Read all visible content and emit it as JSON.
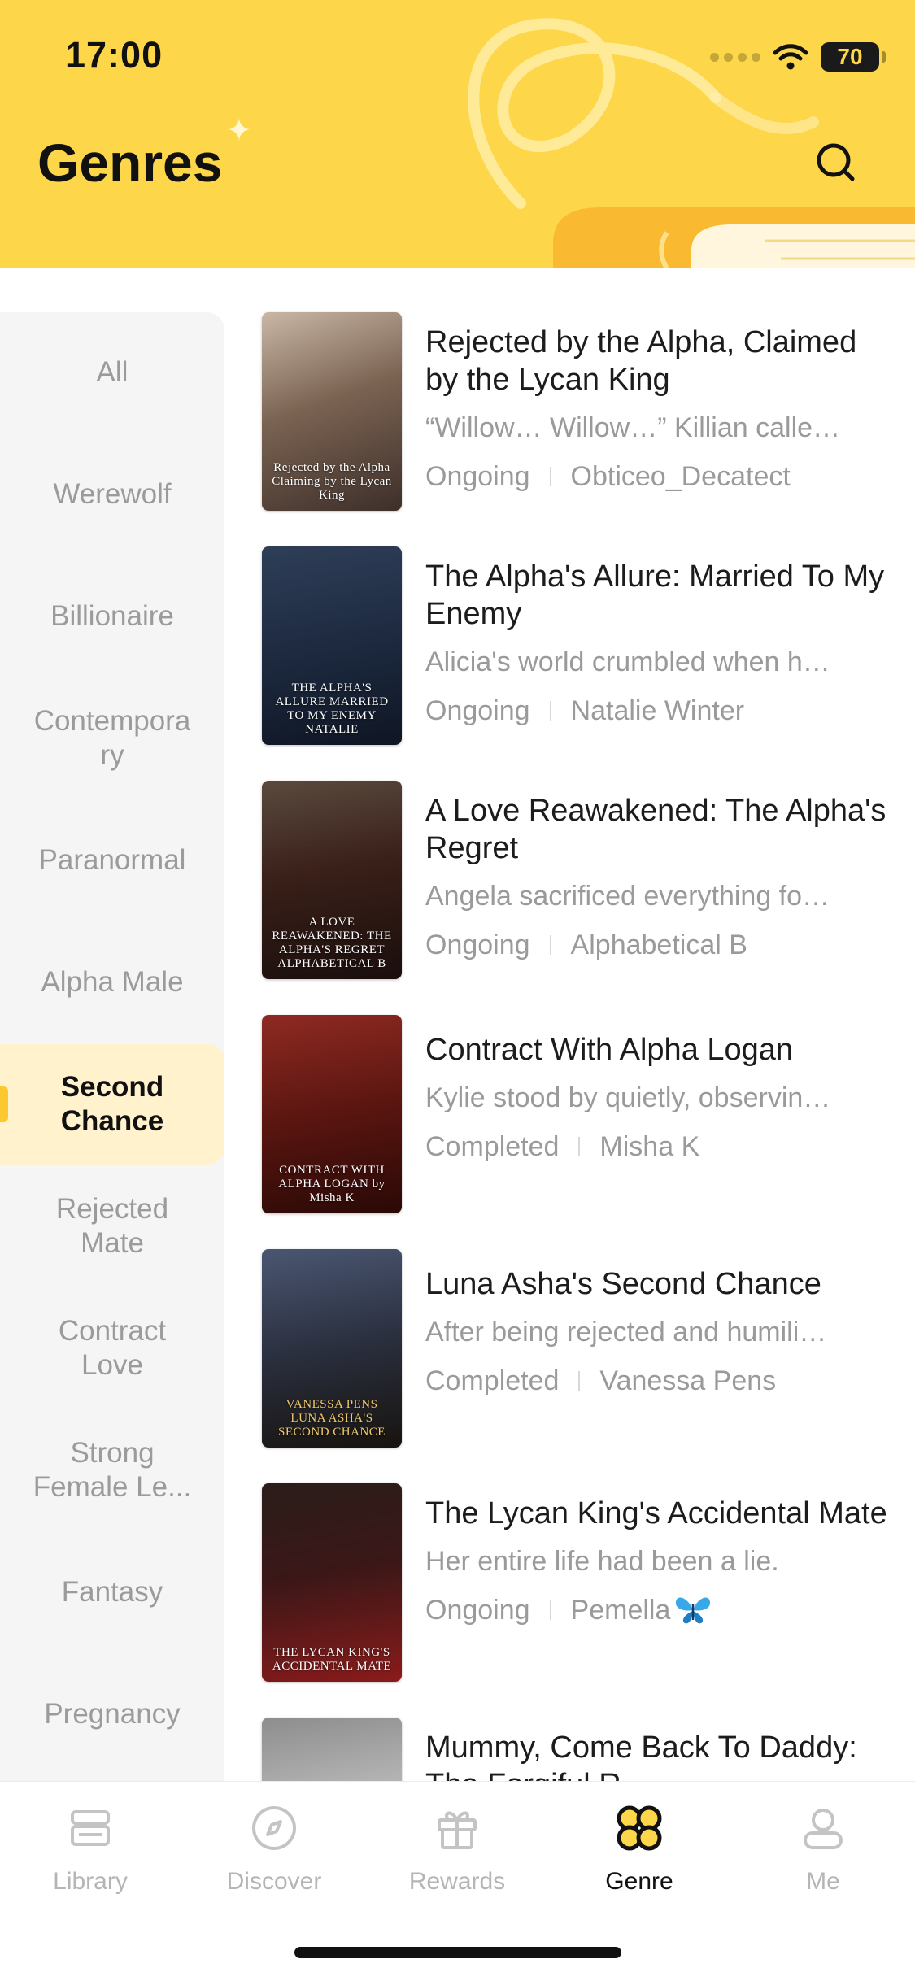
{
  "status_bar": {
    "time": "17:00",
    "battery": "70"
  },
  "header": {
    "title": "Genres"
  },
  "colors": {
    "accent": "#fdd64a",
    "active_bg": "#fff2cc",
    "sidebar_bg": "#f5f5f5",
    "muted": "#9a9a9a"
  },
  "sidebar": {
    "items": [
      {
        "label": "All"
      },
      {
        "label": "Werewolf"
      },
      {
        "label": "Billionaire"
      },
      {
        "label": "Contemporary"
      },
      {
        "label": "Paranormal"
      },
      {
        "label": "Alpha Male"
      },
      {
        "label": "Second Chance",
        "active": true
      },
      {
        "label": "Rejected Mate"
      },
      {
        "label": "Contract Love"
      },
      {
        "label": "Strong Female Le..."
      },
      {
        "label": "Fantasy"
      },
      {
        "label": "Pregnancy"
      }
    ]
  },
  "books": [
    {
      "title": "Rejected by the Alpha, Claimed by the Lycan King",
      "description": "“Willow… Willow…” Killian calle…",
      "status": "Ongoing",
      "author": "Obticeo_Decatect",
      "cover_text": "Rejected by the Alpha Claiming by the Lycan King"
    },
    {
      "title": "The Alpha's Allure: Married To My Enemy",
      "description": "Alicia's world crumbled when h…",
      "status": "Ongoing",
      "author": "Natalie Winter",
      "cover_text": "THE ALPHA'S ALLURE MARRIED TO MY ENEMY NATALIE"
    },
    {
      "title": "A Love Reawakened: The Alpha's Regret",
      "description": "Angela sacrificed everything fo…",
      "status": "Ongoing",
      "author": "Alphabetical B",
      "cover_text": "A LOVE REAWAKENED: THE ALPHA'S REGRET ALPHABETICAL B"
    },
    {
      "title": "Contract With Alpha Logan",
      "description": "Kylie stood by quietly, observin…",
      "status": "Completed",
      "author": "Misha K",
      "cover_text": "CONTRACT WITH ALPHA LOGAN by Misha K"
    },
    {
      "title": "Luna Asha's Second Chance",
      "description": "After being rejected and humili…",
      "status": "Completed",
      "author": "Vanessa Pens",
      "cover_text": "VANESSA PENS LUNA ASHA'S SECOND CHANCE"
    },
    {
      "title": "The Lycan King's Accidental Mate",
      "description": "Her entire life had been a lie.",
      "status": "Ongoing",
      "author": "Pemella",
      "author_emoji": "butterfly",
      "cover_text": "THE LYCAN KING'S ACCIDENTAL MATE"
    },
    {
      "title": "Mummy, Come Back To Daddy: The Forgiful R…",
      "description": "",
      "status": "",
      "author": "",
      "cover_text": ""
    }
  ],
  "tabbar": {
    "tabs": [
      {
        "label": "Library",
        "icon": "library-icon"
      },
      {
        "label": "Discover",
        "icon": "compass-icon"
      },
      {
        "label": "Rewards",
        "icon": "gift-icon"
      },
      {
        "label": "Genre",
        "icon": "genre-icon",
        "active": true
      },
      {
        "label": "Me",
        "icon": "person-icon"
      }
    ]
  }
}
